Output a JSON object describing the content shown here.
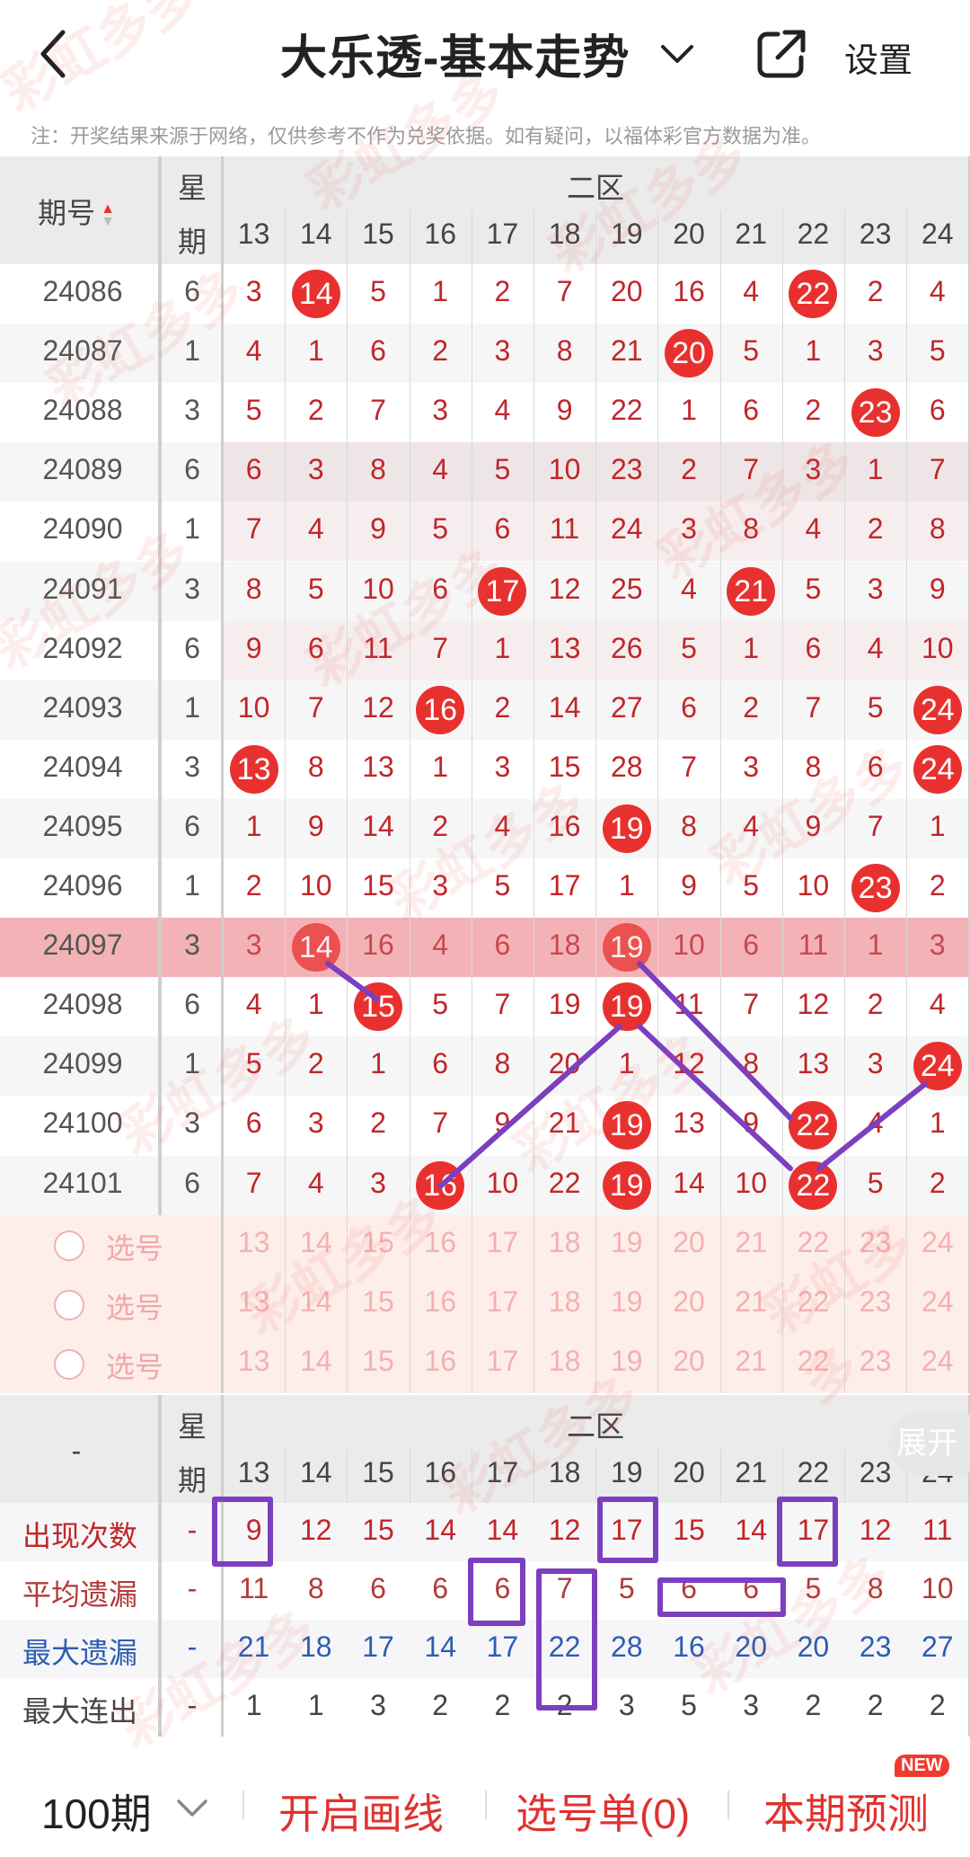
{
  "header": {
    "title": "大乐透-基本走势",
    "settings": "设置"
  },
  "notice": "注：开奖结果来源于网络，仅供参考不作为兑奖依据。如有疑问，以福体彩官方数据为准。",
  "table": {
    "period_header": "期号",
    "week_header_top": "星",
    "week_header_bottom": "期",
    "zone_label": "二区",
    "columns": [
      "13",
      "14",
      "15",
      "16",
      "17",
      "18",
      "19",
      "20",
      "21",
      "22",
      "23",
      "24"
    ],
    "rows": [
      {
        "period": "24086",
        "week": "6",
        "cells": [
          "3",
          "14",
          "5",
          "1",
          "2",
          "7",
          "20",
          "16",
          "4",
          "22",
          "2",
          "4"
        ],
        "hits": [
          1,
          9
        ]
      },
      {
        "period": "24087",
        "week": "1",
        "cells": [
          "4",
          "1",
          "6",
          "2",
          "3",
          "8",
          "21",
          "20",
          "5",
          "1",
          "3",
          "5"
        ],
        "hits": [
          7
        ]
      },
      {
        "period": "24088",
        "week": "3",
        "cells": [
          "5",
          "2",
          "7",
          "3",
          "4",
          "9",
          "22",
          "1",
          "6",
          "2",
          "23",
          "6"
        ],
        "hits": [
          10
        ]
      },
      {
        "period": "24089",
        "week": "6",
        "cells": [
          "6",
          "3",
          "8",
          "4",
          "5",
          "10",
          "23",
          "2",
          "7",
          "3",
          "1",
          "7"
        ],
        "hits": []
      },
      {
        "period": "24090",
        "week": "1",
        "cells": [
          "7",
          "4",
          "9",
          "5",
          "6",
          "11",
          "24",
          "3",
          "8",
          "4",
          "2",
          "8"
        ],
        "hits": []
      },
      {
        "period": "24091",
        "week": "3",
        "cells": [
          "8",
          "5",
          "10",
          "6",
          "17",
          "12",
          "25",
          "4",
          "21",
          "5",
          "3",
          "9"
        ],
        "hits": [
          4,
          8
        ]
      },
      {
        "period": "24092",
        "week": "6",
        "cells": [
          "9",
          "6",
          "11",
          "7",
          "1",
          "13",
          "26",
          "5",
          "1",
          "6",
          "4",
          "10"
        ],
        "hits": []
      },
      {
        "period": "24093",
        "week": "1",
        "cells": [
          "10",
          "7",
          "12",
          "16",
          "2",
          "14",
          "27",
          "6",
          "2",
          "7",
          "5",
          "24"
        ],
        "hits": [
          3,
          11
        ]
      },
      {
        "period": "24094",
        "week": "3",
        "cells": [
          "13",
          "8",
          "13",
          "1",
          "3",
          "15",
          "28",
          "7",
          "3",
          "8",
          "6",
          "24"
        ],
        "hits": [
          0,
          11
        ]
      },
      {
        "period": "24095",
        "week": "6",
        "cells": [
          "1",
          "9",
          "14",
          "2",
          "4",
          "16",
          "19",
          "8",
          "4",
          "9",
          "7",
          "1"
        ],
        "hits": [
          6
        ]
      },
      {
        "period": "24096",
        "week": "1",
        "cells": [
          "2",
          "10",
          "15",
          "3",
          "5",
          "17",
          "1",
          "9",
          "5",
          "10",
          "23",
          "2"
        ],
        "hits": [
          10
        ]
      },
      {
        "period": "24097",
        "week": "3",
        "cells": [
          "3",
          "14",
          "16",
          "4",
          "6",
          "18",
          "19",
          "10",
          "6",
          "11",
          "1",
          "3"
        ],
        "hits": [
          1,
          6
        ]
      },
      {
        "period": "24098",
        "week": "6",
        "cells": [
          "4",
          "1",
          "15",
          "5",
          "7",
          "19",
          "19",
          "11",
          "7",
          "12",
          "2",
          "4"
        ],
        "hits": [
          2,
          6
        ]
      },
      {
        "period": "24099",
        "week": "1",
        "cells": [
          "5",
          "2",
          "1",
          "6",
          "8",
          "20",
          "1",
          "12",
          "8",
          "13",
          "3",
          "24"
        ],
        "hits": [
          11
        ]
      },
      {
        "period": "24100",
        "week": "3",
        "cells": [
          "6",
          "3",
          "2",
          "7",
          "9",
          "21",
          "19",
          "13",
          "9",
          "22",
          "4",
          "1"
        ],
        "hits": [
          6,
          9
        ]
      },
      {
        "period": "24101",
        "week": "6",
        "cells": [
          "7",
          "4",
          "3",
          "16",
          "10",
          "22",
          "19",
          "14",
          "10",
          "22",
          "5",
          "2"
        ],
        "hits": [
          3,
          6,
          9
        ]
      }
    ],
    "picker_label": "选号",
    "picker_rows": 3
  },
  "stats": {
    "corner": "-",
    "week_header_top": "星",
    "week_header_bottom": "期",
    "zone_label": "二区",
    "expand": "展开",
    "rows": [
      {
        "label": "出现次数",
        "week": "-",
        "values": [
          "9",
          "12",
          "15",
          "14",
          "14",
          "12",
          "17",
          "15",
          "14",
          "17",
          "12",
          "11"
        ],
        "color": "#c0262a",
        "label_color": "#c0262a"
      },
      {
        "label": "平均遗漏",
        "week": "-",
        "values": [
          "11",
          "8",
          "6",
          "6",
          "6",
          "7",
          "5",
          "6",
          "6",
          "5",
          "8",
          "10"
        ],
        "color": "#b23a3a",
        "label_color": "#b23a3a"
      },
      {
        "label": "最大遗漏",
        "week": "-",
        "values": [
          "21",
          "18",
          "17",
          "14",
          "17",
          "22",
          "28",
          "16",
          "20",
          "20",
          "23",
          "27"
        ],
        "color": "#2d5db3",
        "label_color": "#2d5db3"
      },
      {
        "label": "最大连出",
        "week": "-",
        "values": [
          "1",
          "1",
          "3",
          "2",
          "2",
          "2",
          "3",
          "5",
          "3",
          "2",
          "2",
          "2"
        ],
        "color": "#444444",
        "label_color": "#444444"
      }
    ]
  },
  "bottom": {
    "periods": "100期",
    "draw_lines": "开启画线",
    "selection": "选号单(0)",
    "prediction": "本期预测",
    "new_badge": "NEW"
  },
  "colors": {
    "accent": "#e8312f",
    "annotation": "#7b3fbf",
    "header_bg": "#ebebeb",
    "picker_bg": "#fdeeea",
    "highlight_row": "#f3b3b6"
  },
  "watermark": "彩虹多多"
}
